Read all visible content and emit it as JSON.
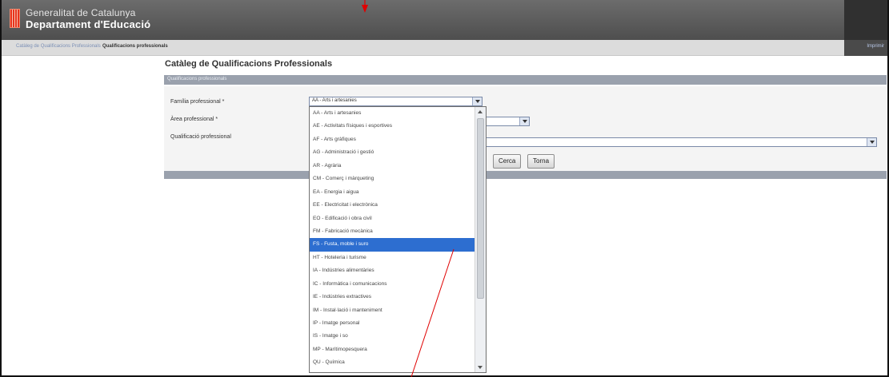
{
  "header": {
    "brand_line1": "Generalitat de Catalunya",
    "brand_line2": "Departament d'Educació"
  },
  "breadcrumb": {
    "parent": "Catàleg de Qualificacions Professionals",
    "current": "Qualificacions professionals",
    "print_link": "Imprimir"
  },
  "page": {
    "title": "Catàleg de Qualificacions Professionals",
    "section_title": "Qualificacions professionals"
  },
  "form": {
    "familia_label": "Família professional *",
    "area_label": "Àrea professional *",
    "qualificacio_label": "Qualificació professional",
    "familia_value": "AA - Arts i artesanies",
    "cerca_label": "Cerca",
    "torna_label": "Torna"
  },
  "dropdown": {
    "selected_index": 10,
    "options": [
      "AA - Arts i artesanies",
      "AE - Activitats físiques i esportives",
      "AF - Arts gràfiques",
      "AG - Administració i gestió",
      "AR - Agrària",
      "CM - Comerç i màrqueting",
      "EA - Energia i aigua",
      "EE - Electricitat i electrònica",
      "EO - Edificació i obra civil",
      "FM - Fabricació mecànica",
      "FS - Fusta, moble i suro",
      "HT - Hoteleria i turisme",
      "IA - Indústries alimentàries",
      "IC - Informàtica i comunicacions",
      "IE - Indústries extractives",
      "IM - Instal·lació i manteniment",
      "IP - Imatge personal",
      "IS - Imatge i so",
      "MP - Marítimopesquera",
      "QU - Química"
    ]
  },
  "annotation_color": "#e00000"
}
